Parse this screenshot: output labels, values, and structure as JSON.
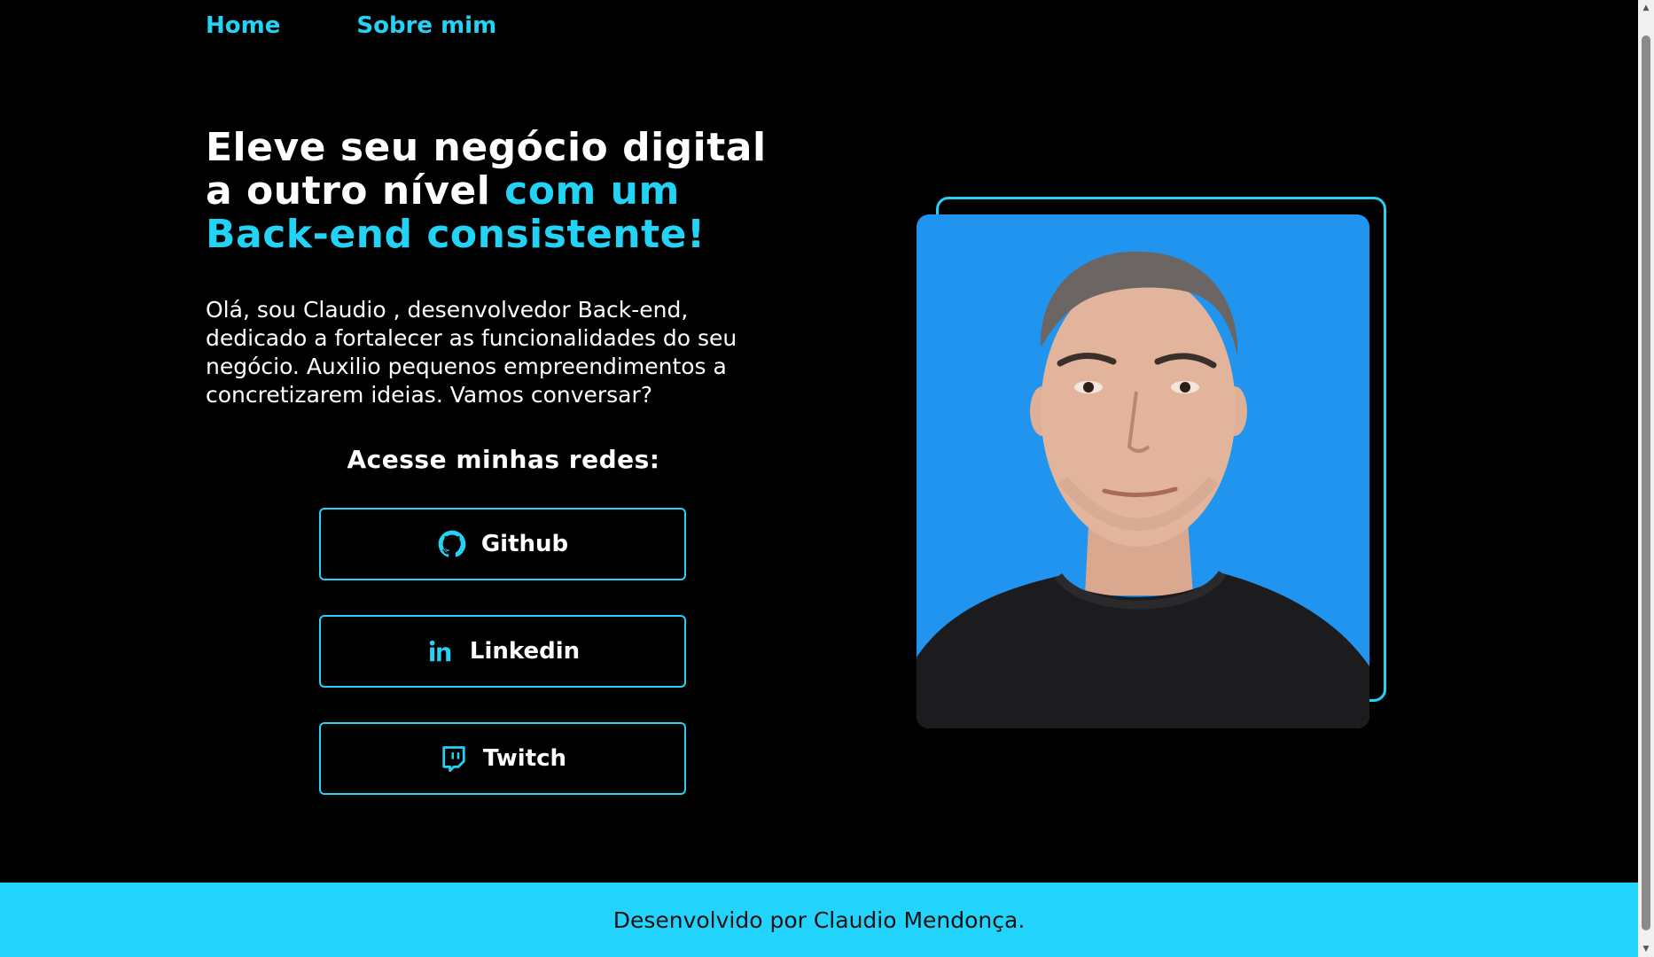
{
  "nav": {
    "items": [
      {
        "label": "Home"
      },
      {
        "label": "Sobre mim"
      }
    ]
  },
  "hero": {
    "title_line1": "Eleve seu negócio digital",
    "title_line2_white": "a outro nível ",
    "title_line2_accent": "com um",
    "title_line3_accent": "Back-end consistente!",
    "intro": "Olá, sou Claudio , desenvolvedor Back-end, dedicado a fortalecer as funcionalidades do seu negócio. Auxilio pequenos empreendimentos a concretizarem ideias. Vamos conversar?"
  },
  "networks": {
    "title": "Acesse minhas redes:",
    "links": [
      {
        "label": "Github",
        "icon": "github-icon"
      },
      {
        "label": "Linkedin",
        "icon": "linkedin-icon"
      },
      {
        "label": "Twitch",
        "icon": "twitch-icon"
      }
    ]
  },
  "footer": {
    "text": "Desenvolvido por Claudio Mendonça."
  },
  "colors": {
    "accent": "#22d3f5",
    "photo_background": "#2094ef",
    "footer_background": "#22d3fc",
    "page_background": "#000000"
  }
}
